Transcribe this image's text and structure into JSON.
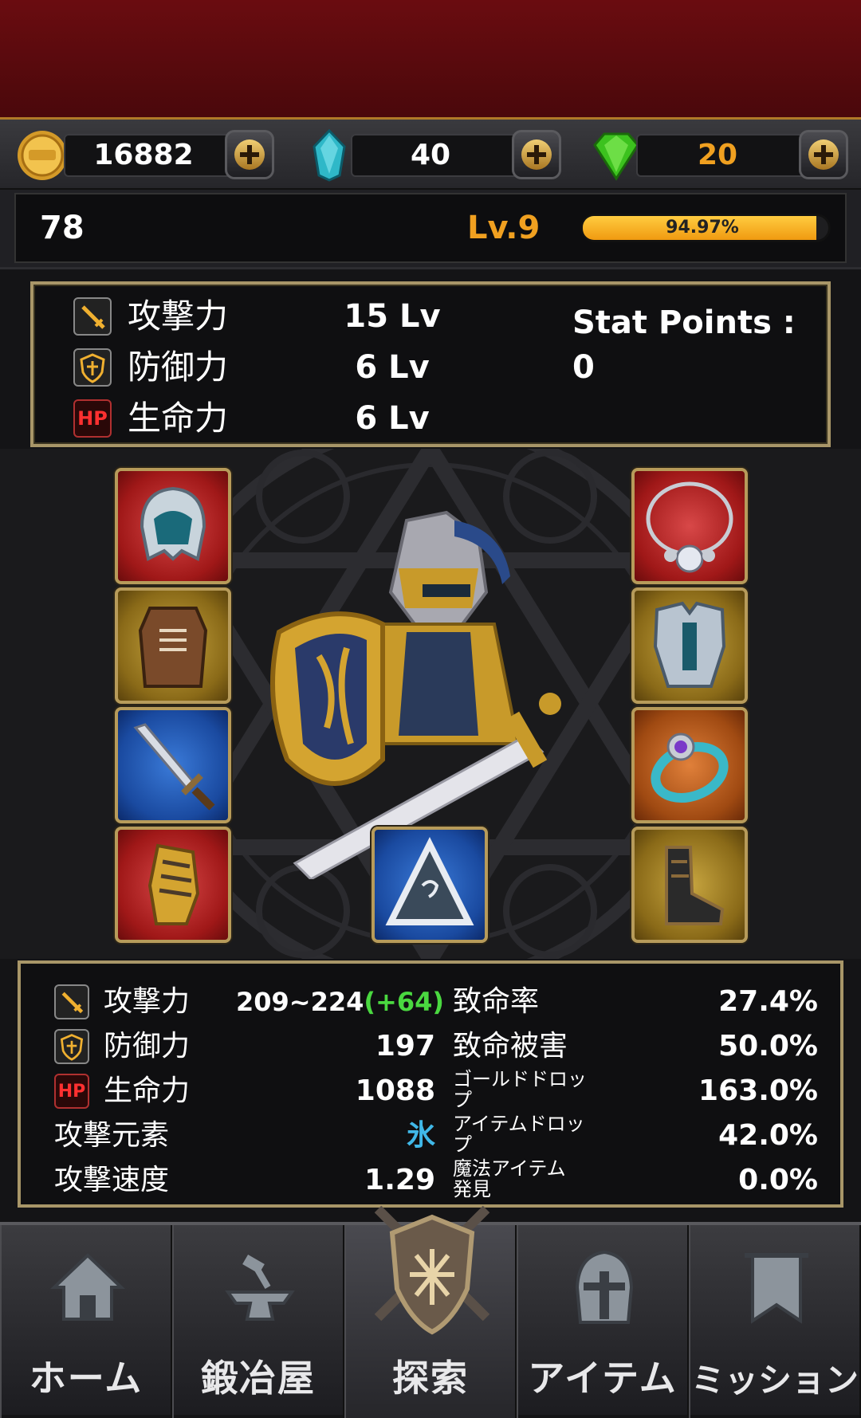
{
  "currency": {
    "gold": "16882",
    "crystal": "40",
    "gem": "20",
    "gem_color": "#f0a020",
    "icons": [
      "gold-coin-icon",
      "blue-crystal-icon",
      "green-gem-icon"
    ]
  },
  "level": {
    "left_value": "78",
    "level_label": "Lv.9",
    "level_color": "#f0a020",
    "exp_percent_label": "94.97%",
    "exp_fraction": 0.9497
  },
  "stats": {
    "attack_label": "攻撃力",
    "attack_lv": "15 Lv",
    "defense_label": "防御力",
    "defense_lv": "6 Lv",
    "life_label": "生命力",
    "life_lv": "6 Lv",
    "hp_badge": "HP",
    "stat_points": "Stat Points : 0"
  },
  "equipment": {
    "left_slots": [
      "helmet",
      "armor-vest",
      "sword",
      "gauntlet"
    ],
    "right_slots": [
      "necklace",
      "plate-armor",
      "ring",
      "boots"
    ],
    "center_slot": "pet-slot"
  },
  "details": {
    "attack_label": "攻撃力",
    "attack_value": "209~224",
    "attack_bonus": "(+64)",
    "defense_label": "防御力",
    "defense_value": "197",
    "life_label": "生命力",
    "life_value": "1088",
    "hp_badge": "HP",
    "element_label": "攻撃元素",
    "element_value": "氷",
    "speed_label": "攻撃速度",
    "speed_value": "1.29",
    "crit_rate_label": "致命率",
    "crit_rate_value": "27.4%",
    "crit_dmg_label": "致命被害",
    "crit_dmg_value": "50.0%",
    "gold_drop_label": "ゴールドドロッ\nプ",
    "gold_drop_value": "163.0%",
    "item_drop_label": "アイテムドロッ\nプ",
    "item_drop_value": "42.0%",
    "magic_item_label": "魔法アイテム\n発見",
    "magic_item_value": "0.0%"
  },
  "nav": {
    "home": "ホーム",
    "smith": "鍛冶屋",
    "explore": "探索",
    "item": "アイテム",
    "mission": "ミッション"
  }
}
